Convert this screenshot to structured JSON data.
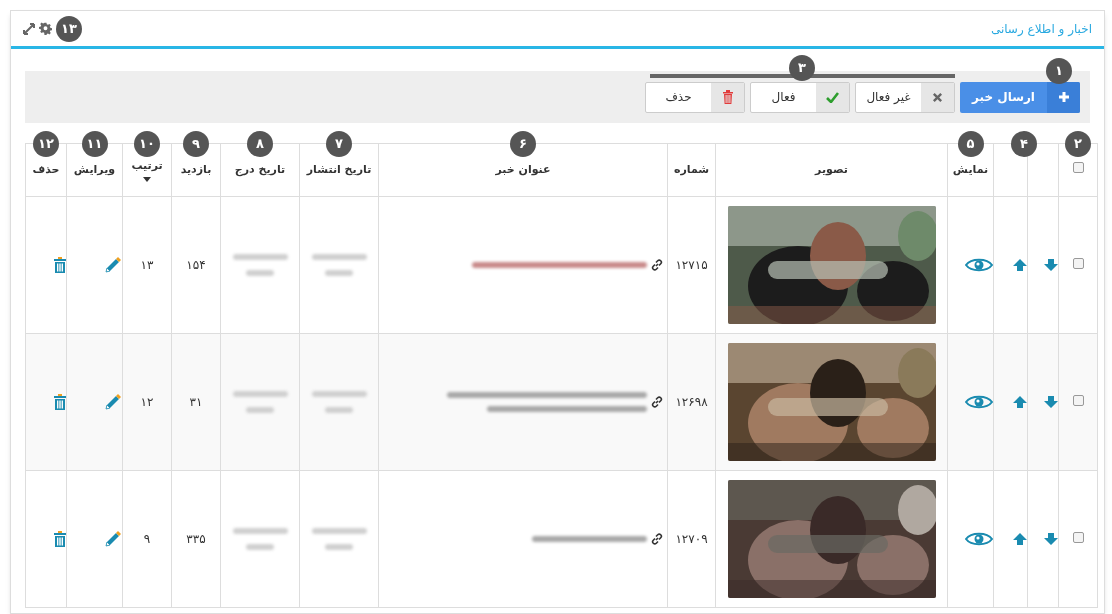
{
  "panel": {
    "title": "اخبار و اطلاع رسانی",
    "badge": "۱۳"
  },
  "toolbar": {
    "buttons": [
      {
        "kind": "primary",
        "label": "ارسال خبر",
        "badge": "۱"
      },
      {
        "kind": "segment",
        "label": "غیر فعال",
        "badge": "۳"
      },
      {
        "kind": "segment",
        "label": "فعال"
      },
      {
        "kind": "plain",
        "label": "حذف"
      }
    ]
  },
  "table": {
    "columns": [
      {
        "kind": "checkbox",
        "badge": "۲",
        "sorted": false
      },
      {
        "kind": "down",
        "sorted": false
      },
      {
        "kind": "up",
        "badge": "۴",
        "sorted": false
      },
      {
        "kind": "view",
        "label": "نمایش",
        "badge": "۵",
        "sorted": false
      },
      {
        "label": "تصویر",
        "sorted": false
      },
      {
        "kind": "number",
        "label": "شماره",
        "sorted": false
      },
      {
        "kind": "title",
        "label": "عنوان خبر",
        "badge": "۶",
        "sorted": false
      },
      {
        "kind": "date",
        "label": "تاریخ انتشار",
        "badge": "۷",
        "sorted": false
      },
      {
        "kind": "date",
        "label": "تاریخ درج",
        "badge": "۸",
        "sorted": false
      },
      {
        "kind": "number",
        "label": "بازدید",
        "badge": "۹",
        "sorted": false
      },
      {
        "kind": "number",
        "label": "ترتیب",
        "badge": "۱۰",
        "sorted": true
      },
      {
        "kind": "edit",
        "label": "ویرایش",
        "badge": "۱۱",
        "sorted": false
      },
      {
        "kind": "delete",
        "label": "حذف",
        "badge": "۱۲",
        "sorted": false
      }
    ],
    "rows": [
      {
        "checked": false,
        "number": "۱۲۷۱۵",
        "title_highlighted": true,
        "views": "۱۵۴",
        "order": "۱۳"
      },
      {
        "checked": false,
        "number": "۱۲۶۹۸",
        "title_highlighted": false,
        "views": "۳۱",
        "order": "۱۲"
      },
      {
        "checked": false,
        "number": "۱۲۷۰۹",
        "title_highlighted": false,
        "views": "۳۳۵",
        "order": "۹"
      }
    ]
  }
}
